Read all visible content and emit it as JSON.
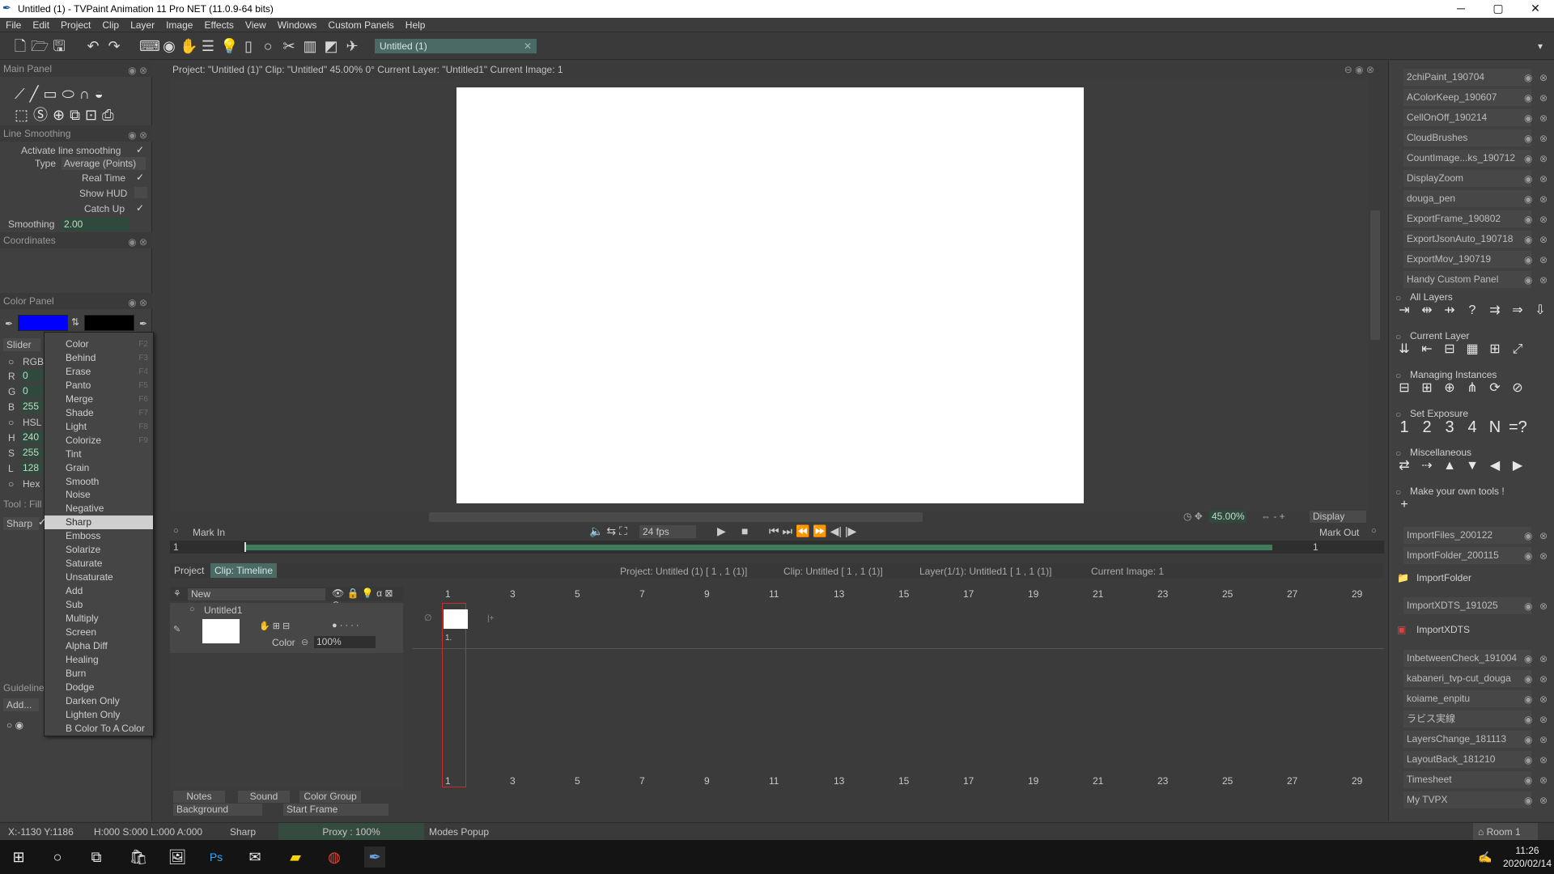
{
  "window": {
    "title": "Untitled (1) - TVPaint Animation 11 Pro NET (11.0.9-64 bits)",
    "minimize": "─",
    "maximize": "▢",
    "close": "✕"
  },
  "menu": [
    "File",
    "Edit",
    "Project",
    "Clip",
    "Layer",
    "Image",
    "Effects",
    "View",
    "Windows",
    "Custom Panels",
    "Help"
  ],
  "toolbar": {
    "project_tab": "Untitled (1)"
  },
  "main_panel": {
    "title": "Main Panel"
  },
  "line_smoothing": {
    "title": "Line Smoothing",
    "activate_label": "Activate line smoothing",
    "type_label": "Type",
    "type_value": "Average (Points)",
    "real_time_label": "Real Time",
    "show_hud_label": "Show HUD",
    "catch_up_label": "Catch Up",
    "smoothing_label": "Smoothing",
    "smoothing_value": "2.00"
  },
  "coordinates": {
    "title": "Coordinates"
  },
  "color_panel": {
    "title": "Color Panel",
    "primary_color": "#0000ff",
    "secondary_color": "#000000"
  },
  "slider": {
    "title": "Slider",
    "rgb": "RGB",
    "r_label": "R",
    "r": "0",
    "g_label": "G",
    "g": "0",
    "b_label": "B",
    "b": "255",
    "hsl": "HSL",
    "h_label": "H",
    "h": "240",
    "s_label": "S",
    "s": "255",
    "l_label": "L",
    "l": "128",
    "hex": "Hex"
  },
  "tool": {
    "label": "Tool : Fill",
    "mode": "Sharp"
  },
  "guidelines": {
    "title": "Guideline",
    "add": "Add..."
  },
  "modes_popup": [
    {
      "label": "Color",
      "key": "F2"
    },
    {
      "label": "Behind",
      "key": "F3"
    },
    {
      "label": "Erase",
      "key": "F4"
    },
    {
      "label": "Panto",
      "key": "F5"
    },
    {
      "label": "Merge",
      "key": "F6"
    },
    {
      "label": "Shade",
      "key": "F7"
    },
    {
      "label": "Light",
      "key": "F8"
    },
    {
      "label": "Colorize",
      "key": "F9"
    },
    {
      "label": "Tint",
      "key": ""
    },
    {
      "label": "Grain",
      "key": ""
    },
    {
      "label": "Smooth",
      "key": ""
    },
    {
      "label": "Noise",
      "key": ""
    },
    {
      "label": "Negative",
      "key": ""
    },
    {
      "label": "Sharp",
      "key": ""
    },
    {
      "label": "Emboss",
      "key": ""
    },
    {
      "label": "Solarize",
      "key": ""
    },
    {
      "label": "Saturate",
      "key": ""
    },
    {
      "label": "Unsaturate",
      "key": ""
    },
    {
      "label": "Add",
      "key": ""
    },
    {
      "label": "Sub",
      "key": ""
    },
    {
      "label": "Multiply",
      "key": ""
    },
    {
      "label": "Screen",
      "key": ""
    },
    {
      "label": "Alpha Diff",
      "key": ""
    },
    {
      "label": "Healing",
      "key": ""
    },
    {
      "label": "Burn",
      "key": ""
    },
    {
      "label": "Dodge",
      "key": ""
    },
    {
      "label": "Darken Only",
      "key": ""
    },
    {
      "label": "Lighten Only",
      "key": ""
    },
    {
      "label": "B Color To A Color",
      "key": ""
    }
  ],
  "view": {
    "header": "Project:  \"Untitled (1)\"  Clip: \"Untitled\"   45.00%   0°  Current Layer: \"Untitled1\"  Current Image: 1",
    "zoom": "45.00%",
    "display": "Display"
  },
  "transport": {
    "mark_in": "Mark In",
    "fps": "24 fps",
    "mark_out": "Mark Out",
    "in_value": "1",
    "out_value": "1"
  },
  "timeline": {
    "tab_project": "Project",
    "tab_clip": "Clip: Timeline",
    "info_project": "Project: Untitled (1) [ 1 , 1  (1)]",
    "info_clip": "Clip: Untitled [ 1 , 1  (1)]",
    "info_layer": "Layer(1/1): Untitled1 [ 1 , 1  (1)]",
    "info_image": "Current Image: 1",
    "new_label": "New",
    "layer_name": "Untitled1",
    "layer_mode": "Color",
    "layer_opacity": "100%",
    "frame_label": "1.",
    "ruler": [
      "1",
      "3",
      "5",
      "7",
      "9",
      "11",
      "13",
      "15",
      "17",
      "19",
      "21",
      "23",
      "25",
      "27",
      "29"
    ],
    "notes": "Notes",
    "sound": "Sound",
    "color_group": "Color Group",
    "background": "Background",
    "start_frame": "Start Frame"
  },
  "right_panel": {
    "items_top": [
      "2chiPaint_190704",
      "AColorKeep_190607",
      "CellOnOff_190214",
      "CloudBrushes",
      "CountImage...ks_190712",
      "DisplayZoom",
      "douga_pen",
      "ExportFrame_190802",
      "ExportJsonAuto_190718",
      "ExportMov_190719",
      "Handy Custom Panel"
    ],
    "sections": [
      "All Layers",
      "Current Layer",
      "Managing Instances",
      "Set Exposure",
      "Miscellaneous",
      "Make your own tools !"
    ],
    "exposure": [
      "1",
      "2",
      "3",
      "4",
      "N",
      "=?"
    ],
    "items_mid": [
      "ImportFiles_200122",
      "ImportFolder_200115"
    ],
    "import_folder": "ImportFolder",
    "import_xdts_item": "ImportXDTS_191025",
    "import_xdts": "ImportXDTS",
    "items_bottom": [
      "InbetweenCheck_191004",
      "kabaneri_tvp-cut_douga",
      "koiame_enpitu",
      "ラビス実線",
      "LayersChange_181113",
      "LayoutBack_181210",
      "Timesheet",
      "My TVPX"
    ],
    "room": "Room 1"
  },
  "status": {
    "coords": "X:-1130  Y:1186",
    "hsla": "H:000 S:000 L:000 A:000",
    "mode": "Sharp",
    "proxy": "Proxy : 100%",
    "modes_popup": "Modes Popup"
  },
  "taskbar": {
    "time": "11:26",
    "date": "2020/02/14"
  }
}
